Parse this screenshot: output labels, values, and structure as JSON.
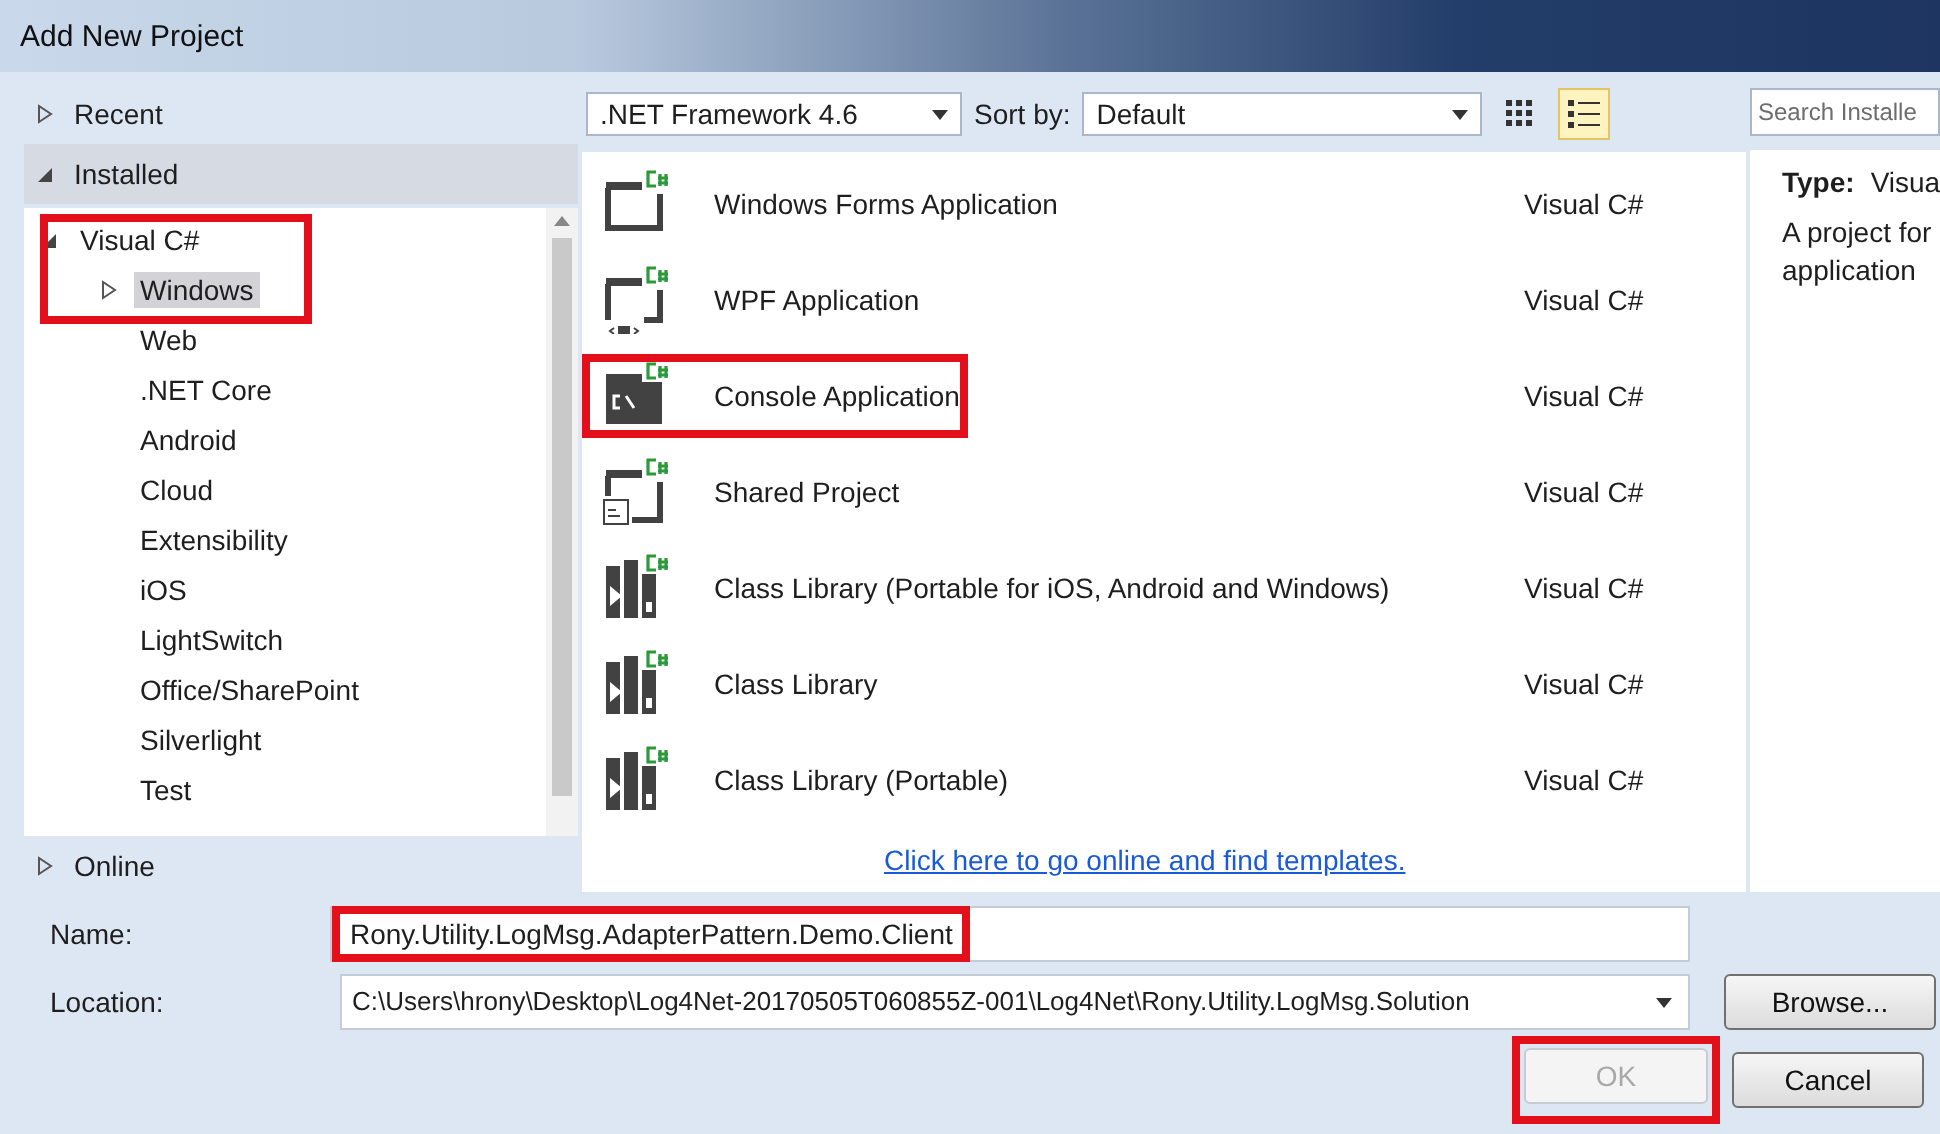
{
  "window": {
    "title": "Add New Project"
  },
  "sidebar": {
    "sections": [
      {
        "label": "Recent",
        "expanded": false,
        "selected": false
      },
      {
        "label": "Installed",
        "expanded": true,
        "selected": true
      },
      {
        "label": "Online",
        "expanded": false,
        "selected": false
      }
    ],
    "tree": [
      {
        "label": "Visual C#",
        "expanded": true,
        "highlighted": true,
        "children": [
          {
            "label": "Windows",
            "selected": true,
            "has_children": true
          },
          {
            "label": "Web",
            "selected": false,
            "has_children": false
          },
          {
            "label": ".NET Core",
            "selected": false,
            "has_children": false
          },
          {
            "label": "Android",
            "selected": false,
            "has_children": false
          },
          {
            "label": "Cloud",
            "selected": false,
            "has_children": false
          },
          {
            "label": "Extensibility",
            "selected": false,
            "has_children": false
          },
          {
            "label": "iOS",
            "selected": false,
            "has_children": false
          },
          {
            "label": "LightSwitch",
            "selected": false,
            "has_children": false
          },
          {
            "label": "Office/SharePoint",
            "selected": false,
            "has_children": false
          },
          {
            "label": "Silverlight",
            "selected": false,
            "has_children": false
          },
          {
            "label": "Test",
            "selected": false,
            "has_children": false
          }
        ]
      }
    ]
  },
  "toolbar": {
    "framework": ".NET Framework 4.6",
    "sort_label": "Sort by:",
    "sort_value": "Default",
    "views": [
      {
        "kind": "grid",
        "selected": false
      },
      {
        "kind": "list",
        "selected": true
      }
    ]
  },
  "templates": [
    {
      "kind": "winforms",
      "name": "Windows Forms Application",
      "language": "Visual C#",
      "highlighted": false
    },
    {
      "kind": "wpf",
      "name": "WPF Application",
      "language": "Visual C#",
      "highlighted": false
    },
    {
      "kind": "console",
      "name": "Console Application",
      "language": "Visual C#",
      "highlighted": true
    },
    {
      "kind": "shared",
      "name": "Shared Project",
      "language": "Visual C#",
      "highlighted": false
    },
    {
      "kind": "library",
      "name": "Class Library (Portable for iOS, Android and Windows)",
      "language": "Visual C#",
      "highlighted": false
    },
    {
      "kind": "library",
      "name": "Class Library",
      "language": "Visual C#",
      "highlighted": false
    },
    {
      "kind": "library",
      "name": "Class Library (Portable)",
      "language": "Visual C#",
      "highlighted": false
    }
  ],
  "online_link": "Click here to go online and find templates.",
  "details": {
    "search": {
      "placeholder": "Search Installe"
    },
    "type_label": "Type:",
    "type_value": "Visua",
    "description": [
      "A project for",
      "application"
    ]
  },
  "form": {
    "name_label": "Name:",
    "name_value": "Rony.Utility.LogMsg.AdapterPattern.Demo.Client",
    "name_highlighted": true,
    "location_label": "Location:",
    "location_value": "C:\\Users\\hrony\\Desktop\\Log4Net-20170505T060855Z-001\\Log4Net\\Rony.Utility.LogMsg.Solution"
  },
  "buttons": [
    {
      "kind": "browse",
      "label": "Browse...",
      "disabled": false,
      "highlighted": false
    },
    {
      "kind": "ok",
      "label": "OK",
      "disabled": true,
      "highlighted": true
    },
    {
      "kind": "cancel",
      "label": "Cancel",
      "disabled": false,
      "highlighted": false
    }
  ]
}
